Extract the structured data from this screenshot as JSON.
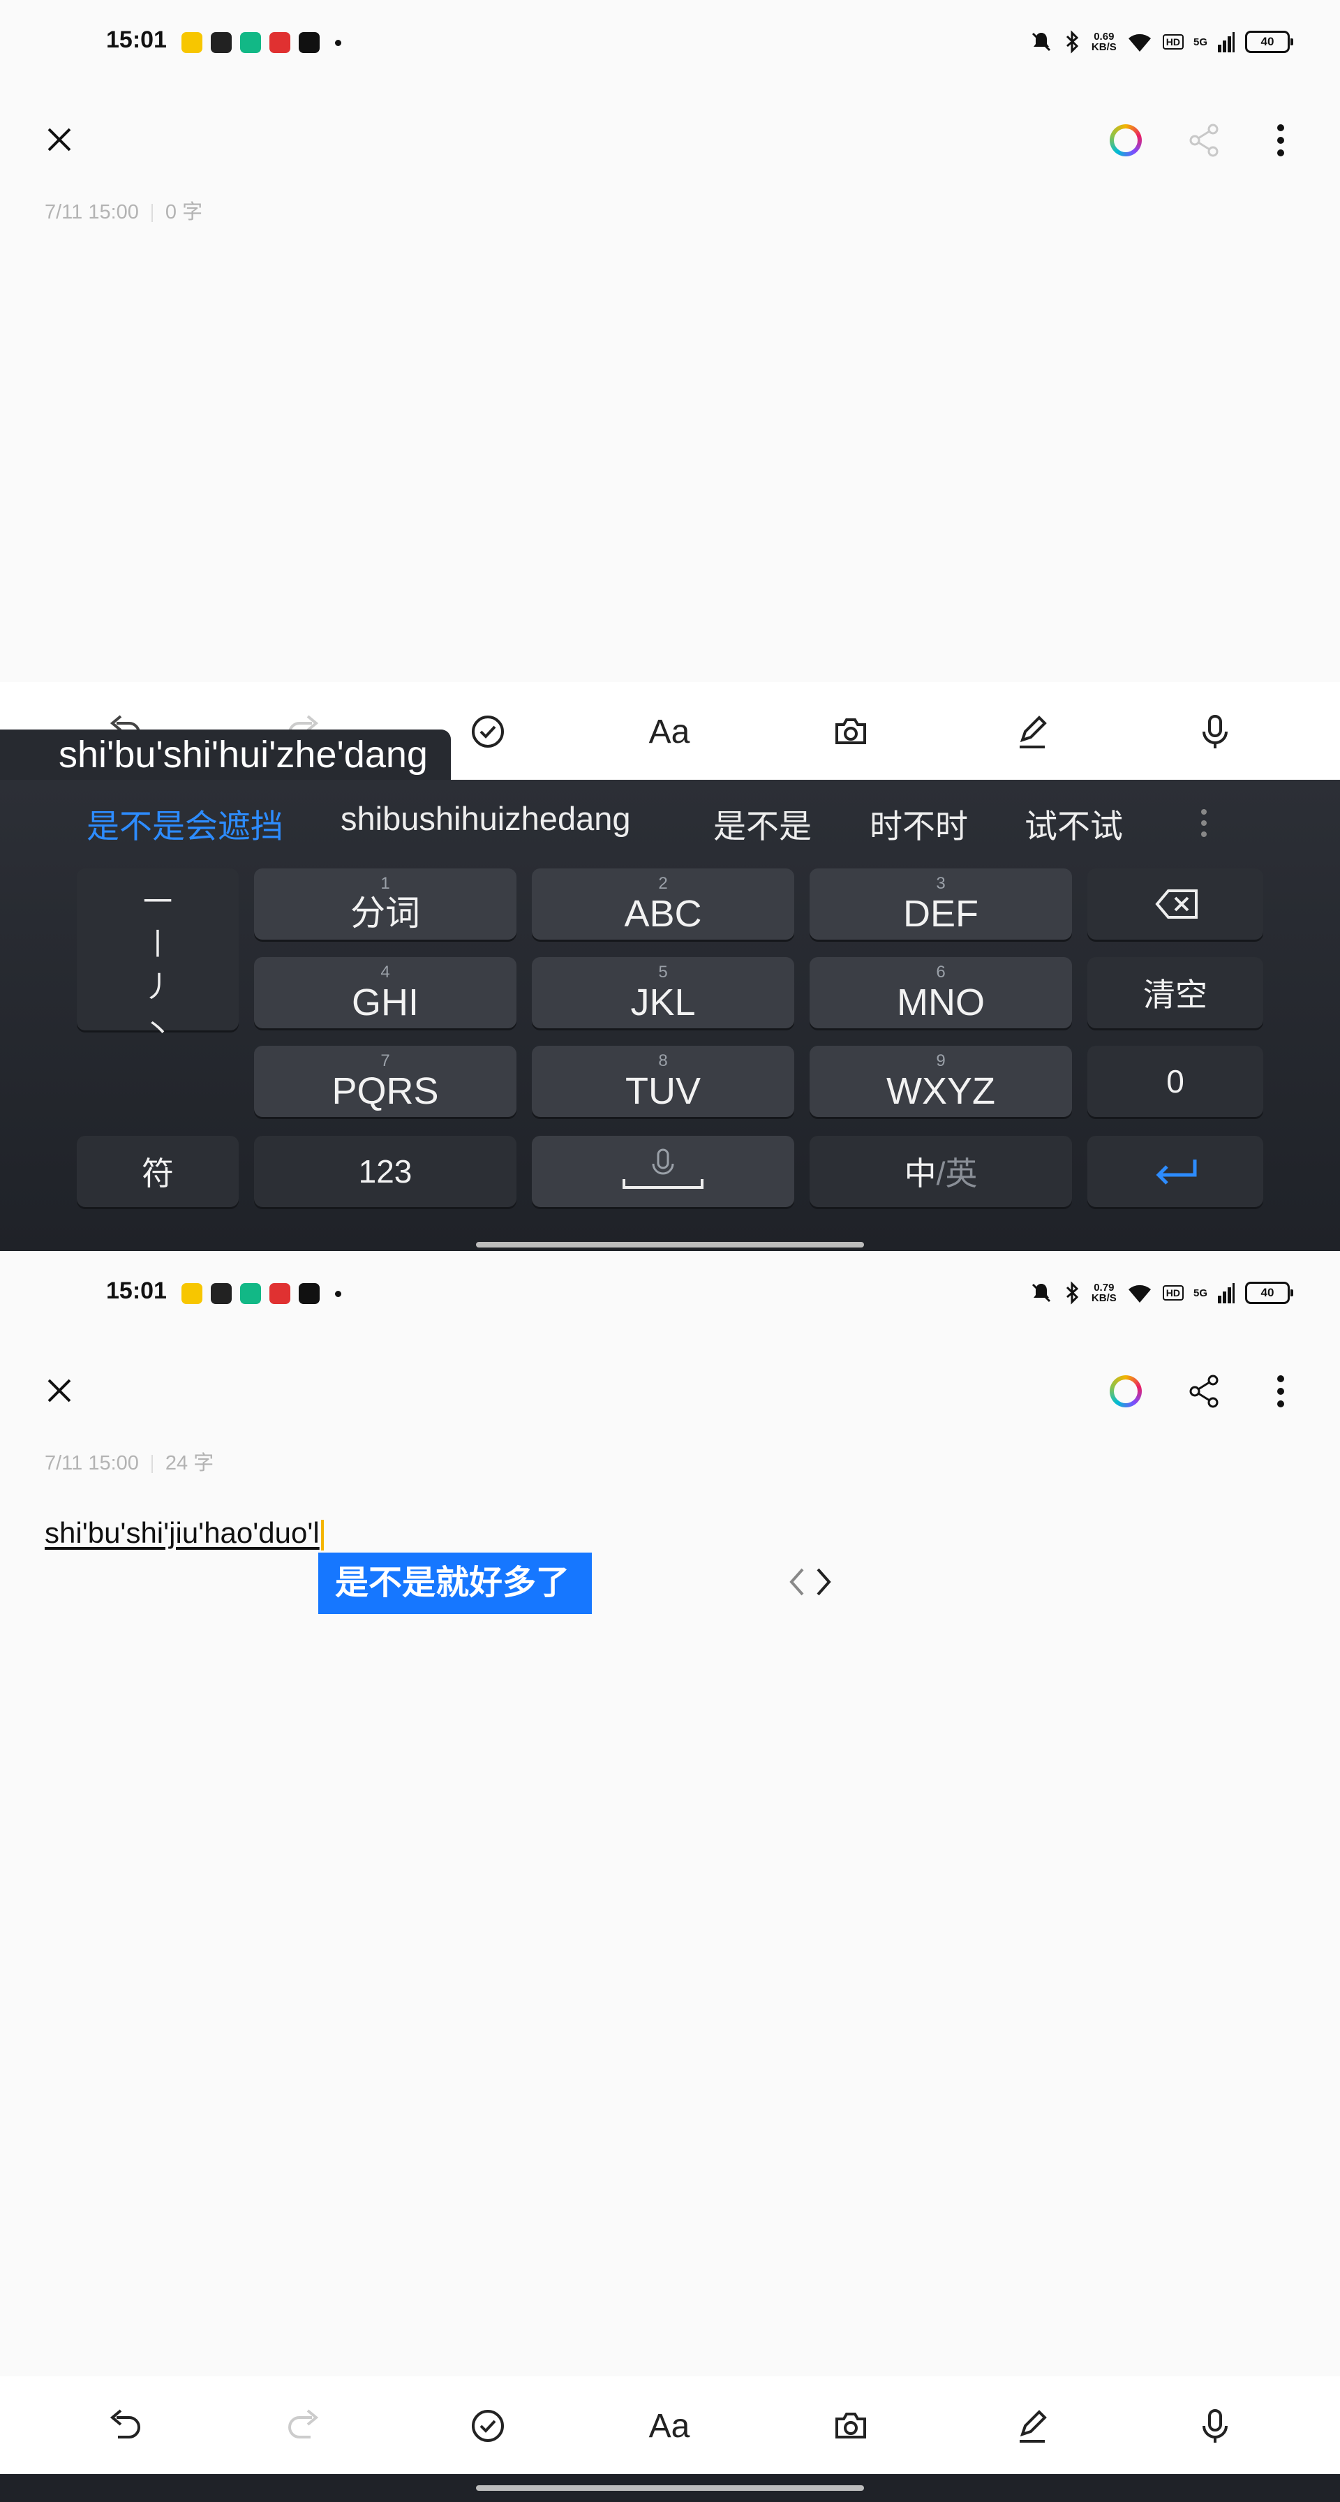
{
  "screen1": {
    "status": {
      "time": "15:01",
      "speed_value": "0.69",
      "speed_unit": "KB/S",
      "battery": "40",
      "hd": "HD",
      "net": "5G"
    },
    "meta": {
      "date": "7/11 15:00",
      "count": "0 字"
    },
    "toolbar": {
      "font_label": "Aa"
    },
    "pinyin_composition": "shi'bu'shi'hui'zhe'dang",
    "candidates": [
      "是不是会遮挡",
      "shibushihuizhedang",
      "是不是",
      "时不时",
      "试不试"
    ],
    "keyboard": {
      "strokes": [
        "一",
        "丨",
        "丿",
        "丶"
      ],
      "keys": [
        {
          "num": "1",
          "label": "分词"
        },
        {
          "num": "2",
          "label": "ABC"
        },
        {
          "num": "3",
          "label": "DEF"
        },
        {
          "num": "4",
          "label": "GHI"
        },
        {
          "num": "5",
          "label": "JKL"
        },
        {
          "num": "6",
          "label": "MNO"
        },
        {
          "num": "7",
          "label": "PQRS"
        },
        {
          "num": "8",
          "label": "TUV"
        },
        {
          "num": "9",
          "label": "WXYZ"
        }
      ],
      "clear": "清空",
      "zero": "0",
      "symbol": "符",
      "numbers": "123",
      "lang_zh": "中",
      "lang_en": "/英"
    }
  },
  "screen2": {
    "status": {
      "time": "15:01",
      "speed_value": "0.79",
      "speed_unit": "KB/S",
      "battery": "40",
      "hd": "HD",
      "net": "5G"
    },
    "meta": {
      "date": "7/11 15:00",
      "count": "24 字"
    },
    "composition": "shi'bu'shi'jiu'hao'duo'l",
    "inline_candidate": "是不是就好多了",
    "toolbar": {
      "font_label": "Aa"
    }
  },
  "colors": {
    "accent": "#2d8cff",
    "candidate_bg": "#1677ff",
    "keyboard_bg": "#2c2f36",
    "key_bg": "#3b3e45"
  }
}
